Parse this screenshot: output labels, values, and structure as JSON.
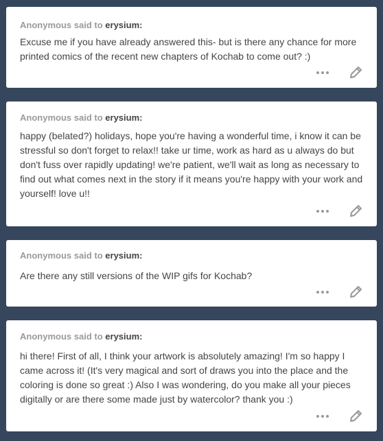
{
  "posts": [
    {
      "asker": "Anonymous",
      "said_to": "said to",
      "blog": "erysium",
      "colon": ":",
      "question": "Excuse me if you have already answered this- but is there any chance for more printed comics of the recent new chapters of Kochab to come out? :)",
      "more_icon": "ellipsis-icon",
      "edit_icon": "pencil-icon"
    },
    {
      "asker": "Anonymous",
      "said_to": "said to",
      "blog": "erysium",
      "colon": ":",
      "question": "happy (belated?) holidays, hope you're having a wonderful time, i know it can be stressful so don't forget to relax!! take ur time, work as hard as u always do but don't fuss over rapidly updating! we're patient, we'll wait as long as necessary to find out what comes next in the story if it means you're happy with your work and yourself! love u!!",
      "more_icon": "ellipsis-icon",
      "edit_icon": "pencil-icon"
    },
    {
      "asker": "Anonymous",
      "said_to": "said to",
      "blog": "erysium",
      "colon": ":",
      "question": "Are there any still versions of the WIP gifs for Kochab?",
      "more_icon": "ellipsis-icon",
      "edit_icon": "pencil-icon"
    },
    {
      "asker": "Anonymous",
      "said_to": "said to",
      "blog": "erysium",
      "colon": ":",
      "question": "hi there! First of all, I think your artwork is absolutely amazing! I'm so happy I came across it! (It's very magical and sort of draws you into the place and the coloring is done so great :) Also I was wondering, do you make all your pieces digitally or are there some made just by watercolor? thank you :)",
      "more_icon": "ellipsis-icon",
      "edit_icon": "pencil-icon"
    }
  ],
  "colors": {
    "background": "#36465d",
    "card": "#ffffff",
    "meta_text": "#9a9a9a",
    "body_text": "#444444",
    "icon": "#999999"
  }
}
